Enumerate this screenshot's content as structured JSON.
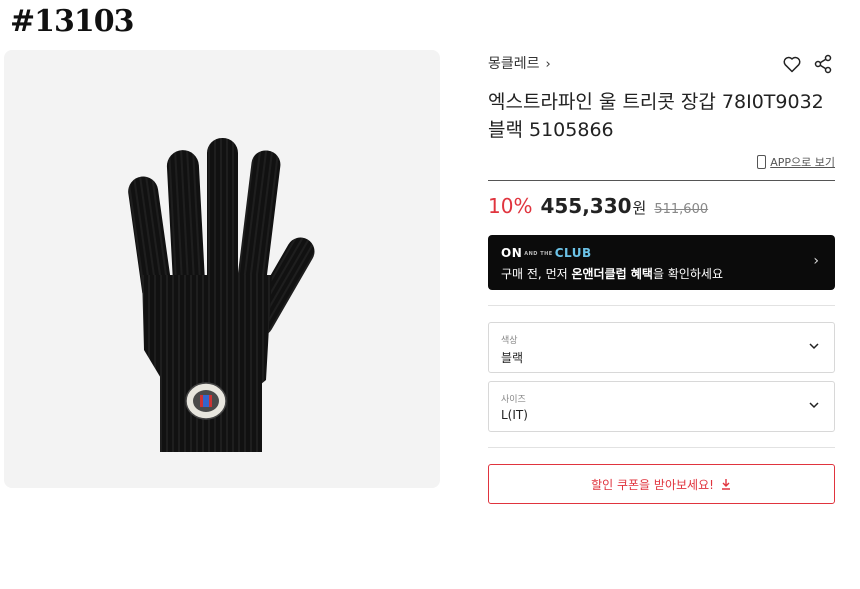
{
  "watermark": "#13103",
  "product": {
    "brand": "몽클레르",
    "brand_chevron": "›",
    "title": "엑스트라파인 울 트리콧 장갑 78I0T9032 블랙 5105866",
    "app_link": "APP으로 보기"
  },
  "price": {
    "discount": "10%",
    "sale": "455,330",
    "currency": "원",
    "original": "511,600"
  },
  "club_banner": {
    "logo_on": "ON",
    "logo_and": "AND THE",
    "logo_club": "CLUB",
    "text_prefix": "구매 전, 먼저 ",
    "text_bold": "온앤더클럽 혜택",
    "text_suffix": "을 확인하세요",
    "chevron": "›"
  },
  "options": [
    {
      "label": "색상",
      "value": "블랙"
    },
    {
      "label": "사이즈",
      "value": "L(IT)"
    }
  ],
  "coupon": {
    "label": "할인 쿠폰을 받아보세요!",
    "icon": "download-icon"
  },
  "icons": {
    "wishlist": "heart-icon",
    "share": "share-icon"
  },
  "colors": {
    "accent": "#e0343e",
    "club_background": "#0b0b0b",
    "club_highlight": "#6cc3e8"
  }
}
